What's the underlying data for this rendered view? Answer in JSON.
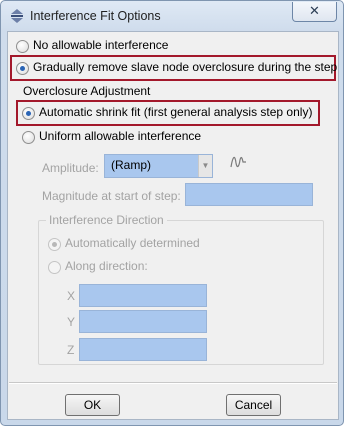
{
  "window": {
    "title": "Interference Fit Options",
    "close_glyph": "✕",
    "icon": "dialog-icon"
  },
  "options": {
    "no_allowable": "No allowable interference",
    "gradually_remove": "Gradually remove slave node overclosure during the step"
  },
  "overclosure": {
    "title": "Overclosure Adjustment",
    "automatic": "Automatic shrink fit (first general analysis step only)",
    "uniform": "Uniform allowable interference",
    "amplitude_label": "Amplitude:",
    "amplitude_value": "(Ramp)",
    "magnitude_label": "Magnitude at start of step:",
    "magnitude_value": ""
  },
  "interference_direction": {
    "title": "Interference Direction",
    "auto": "Automatically determined",
    "along": "Along direction:",
    "x_label": "X",
    "y_label": "Y",
    "z_label": "Z",
    "x_value": "",
    "y_value": "",
    "z_value": ""
  },
  "buttons": {
    "ok": "OK",
    "cancel": "Cancel"
  },
  "colors": {
    "highlight": "#a3182b",
    "field": "#a9c7ee",
    "radio_checked": "#2a64b5"
  }
}
